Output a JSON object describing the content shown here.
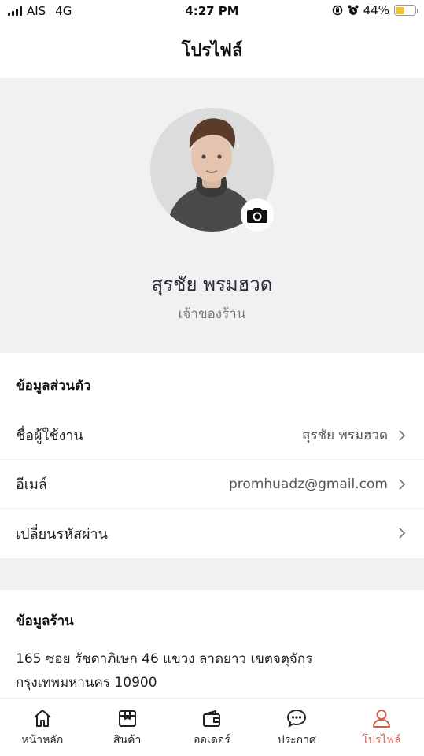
{
  "status_bar": {
    "carrier": "AIS",
    "network": "4G",
    "time": "4:27 PM",
    "battery_percent": "44%",
    "battery_level": 0.44,
    "battery_color": "#f2c230"
  },
  "header": {
    "title": "โปรไฟล์"
  },
  "profile": {
    "name": "สุรชัย พรมฮวด",
    "role": "เจ้าของร้าน",
    "camera_icon": "camera-icon"
  },
  "personal_info": {
    "title": "ข้อมูลส่วนตัว",
    "rows": [
      {
        "label": "ชื่อผู้ใช้งาน",
        "value": "สุรชัย พรมฮวด"
      },
      {
        "label": "อีเมล์",
        "value": "promhuadz@gmail.com"
      },
      {
        "label": "เปลี่ยนรหัสผ่าน",
        "value": ""
      }
    ]
  },
  "shop_info": {
    "title": "ข้อมูลร้าน",
    "address_line1": "165 ซอย รัชดาภิเษก 46 แขวง ลาดยาว เขตจตุจักร",
    "address_line2": "กรุงเทพมหานคร 10900"
  },
  "tabbar": {
    "active_color": "#d0624a",
    "items": [
      {
        "label": "หน้าหลัก",
        "icon": "home-icon"
      },
      {
        "label": "สินค้า",
        "icon": "box-icon"
      },
      {
        "label": "ออเดอร์",
        "icon": "wallet-icon"
      },
      {
        "label": "ประกาศ",
        "icon": "chat-icon"
      },
      {
        "label": "โปรไฟล์",
        "icon": "user-icon"
      }
    ]
  }
}
